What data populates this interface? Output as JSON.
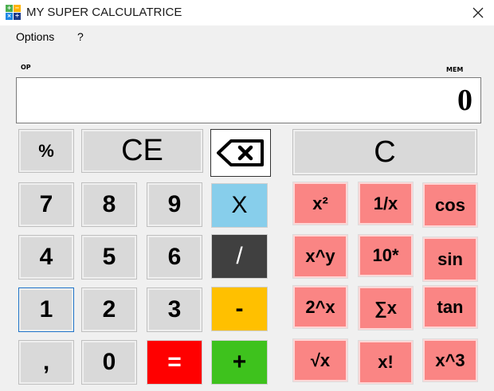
{
  "window": {
    "title": "MY SUPER CALCULATRICE"
  },
  "menu": {
    "items": [
      "Options",
      "?"
    ]
  },
  "labels": {
    "op": "OP",
    "mem": "MEM"
  },
  "display": {
    "value": "0"
  },
  "keypad": {
    "percent": "%",
    "ce": "CE",
    "c": "C",
    "seven": "7",
    "eight": "8",
    "nine": "9",
    "multiply": "X",
    "four": "4",
    "five": "5",
    "six": "6",
    "divide": "/",
    "one": "1",
    "two": "2",
    "three": "3",
    "minus": "-",
    "comma": ",",
    "zero": "0",
    "equals": "=",
    "plus": "+"
  },
  "scientific": {
    "square": "x²",
    "reciprocal": "1/x",
    "cos": "cos",
    "power": "x^y",
    "ten_power": "10*",
    "sin": "sin",
    "two_power": "2^x",
    "sum": "∑x",
    "tan": "tan",
    "sqrt": "√x",
    "factorial": "x!",
    "cube": "x^3"
  },
  "colors": {
    "multiply": "#87ceeb",
    "divide": "#404040",
    "minus": "#ffc000",
    "equals": "#ff0000",
    "plus": "#3ec21d",
    "scientific": "#fa8584",
    "standard": "#d9d9d9"
  },
  "icons": {
    "app": "calculator-app-icon",
    "close": "close-icon",
    "backspace": "backspace-icon"
  }
}
